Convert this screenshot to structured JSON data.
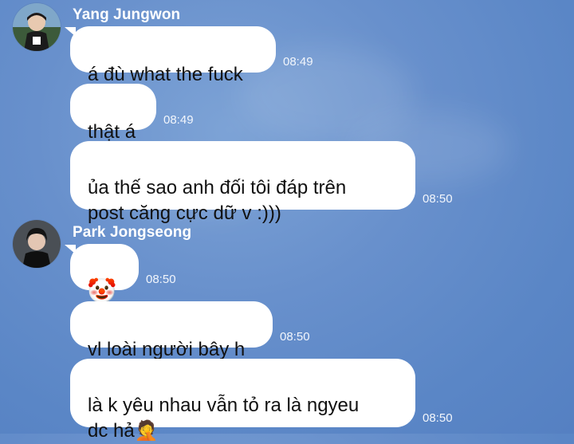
{
  "senders": {
    "first": "Yang Jungwon",
    "second": "Park Jongseong"
  },
  "messages": [
    {
      "text": "á đù what the fuck",
      "time": "08:49"
    },
    {
      "text": "thật á",
      "time": "08:49"
    },
    {
      "text": "ủa thế sao anh đối tôi đáp trên\npost căng cực dữ v :)))",
      "time": "08:50"
    },
    {
      "text": "🤡",
      "time": "08:50"
    },
    {
      "text": "vl loài người bây h",
      "time": "08:50"
    },
    {
      "text": "là k yêu nhau vẫn tỏ ra là ngyeu\ndc hả🤦",
      "time": "08:50"
    }
  ],
  "icons": {
    "avatar1": "avatar-yang-jungwon",
    "avatar2": "avatar-park-jongseong"
  }
}
